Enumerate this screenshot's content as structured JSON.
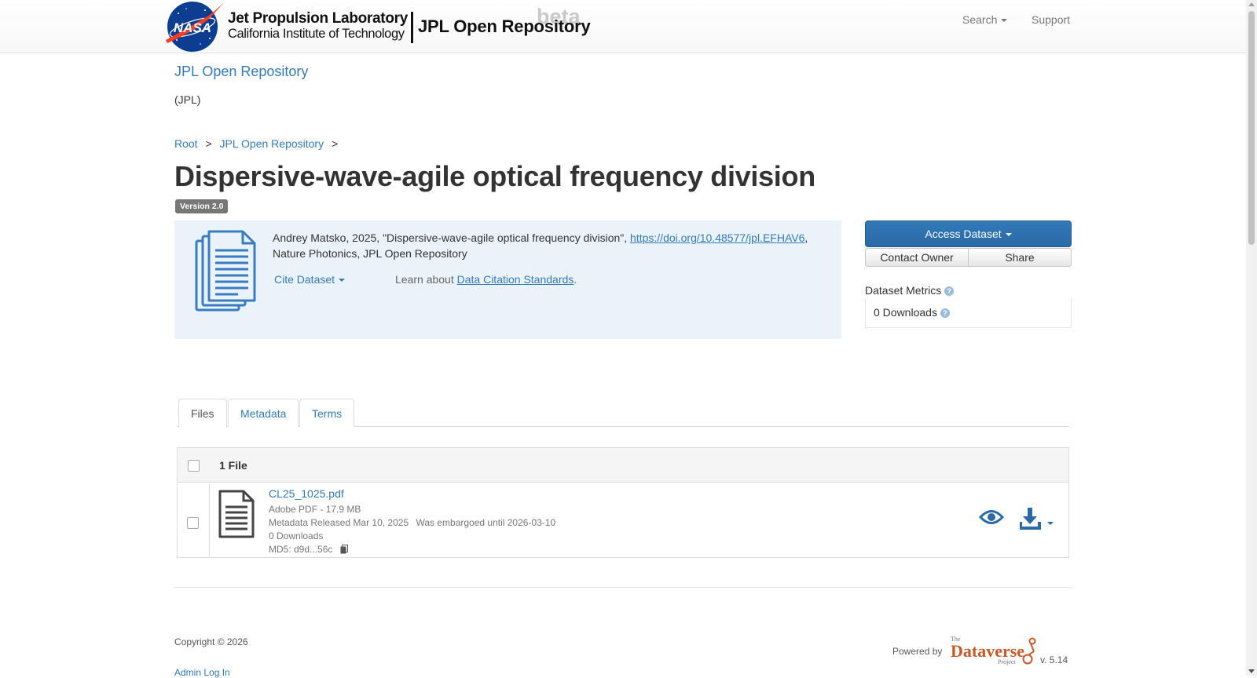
{
  "navbar": {
    "lab_name": "Jet Propulsion Laboratory",
    "lab_sub": "California Institute of Technology",
    "repo_name": "JPL Open Repository",
    "beta": "beta",
    "nasa_text": "NASA",
    "search": "Search",
    "support": "Support"
  },
  "dataverse": {
    "title": "JPL Open Repository",
    "affiliation": "(JPL)"
  },
  "breadcrumb": {
    "items": [
      "Root",
      "JPL Open Repository"
    ],
    "separator": ">"
  },
  "dataset": {
    "title": "Dispersive-wave-agile optical frequency division",
    "version": "Version 2.0"
  },
  "citation": {
    "text_before": "Andrey Matsko, 2025, \"Dispersive-wave-agile optical frequency division\",",
    "doi": "https://doi.org/10.48577/jpl.EFHAV6",
    "text_after": ", Nature Photonics, JPL Open Repository",
    "cite_label": "Cite Dataset",
    "learn_prefix": "Learn about ",
    "learn_link": "Data Citation Standards",
    "learn_suffix": "."
  },
  "actions": {
    "access": "Access Dataset",
    "contact": "Contact Owner",
    "share": "Share"
  },
  "metrics": {
    "label": "Dataset Metrics",
    "downloads": "0 Downloads",
    "help_glyph": "?"
  },
  "tabs": [
    {
      "label": "Files",
      "active": true
    },
    {
      "label": "Metadata",
      "active": false
    },
    {
      "label": "Terms",
      "active": false
    }
  ],
  "files": {
    "count_label": "1 File",
    "items": [
      {
        "name": "CL25_1025.pdf",
        "type_size": "Adobe PDF - 17.9 MB",
        "released": "Metadata Released Mar 10, 2025",
        "embargo": "Was embargoed until 2026-03-10",
        "downloads": "0 Downloads",
        "md5": "MD5: d9d...56c"
      }
    ]
  },
  "footer": {
    "copyright": "Copyright © 2026",
    "admin": "Admin Log In",
    "powered_by": "Powered by",
    "logo_the": "The",
    "logo_name": "Dataverse",
    "logo_project": "Project",
    "version": "v. 5.14"
  },
  "colors": {
    "link": "#337ab7",
    "primary": "#2a6aa5",
    "citation_bg": "#ebf3fa",
    "nasa_blue": "#0b3d91",
    "nasa_red": "#fc3d21",
    "dataverse_orange": "#c55b28"
  }
}
